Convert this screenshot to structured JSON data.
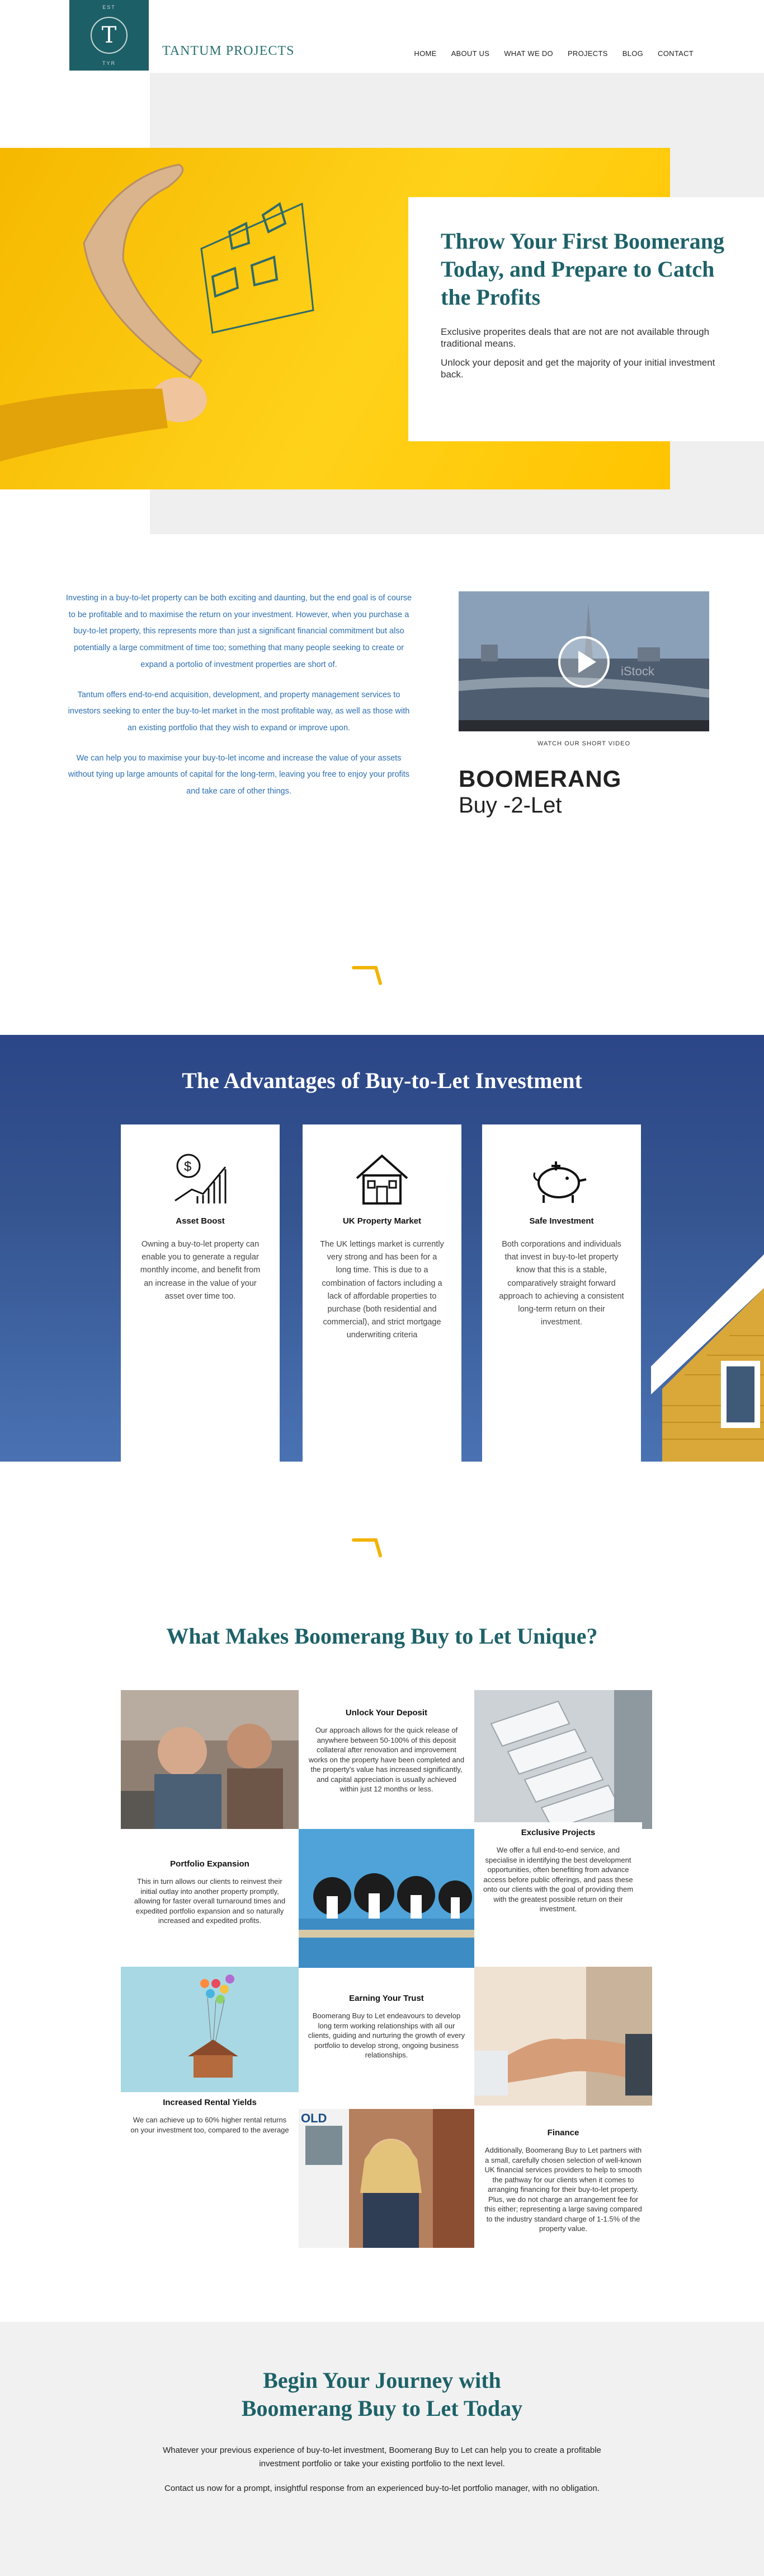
{
  "header": {
    "logo_letter": "T",
    "logo_top": "EST",
    "logo_bottom": "TYR",
    "brand": "TANTUM PROJECTS",
    "nav": [
      "HOME",
      "ABOUT US",
      "WHAT WE DO",
      "PROJECTS",
      "BLOG",
      "CONTACT"
    ]
  },
  "hero": {
    "title": "Throw Your First Boomerang Today, and Prepare to Catch the Profits",
    "p1": "Exclusive properites deals that are not are not available through traditional means.",
    "p2": "Unlock your deposit and get the majority of your initial investment back."
  },
  "intro": {
    "p1": "Investing in a buy-to-let property can be both exciting and daunting, but the end goal is of course to be profitable and to maximise the return on your investment. However, when you purchase a buy-to-let property, this represents more than just a significant financial commitment but also potentially a large commitment of time too; something that many people seeking to create or expand a portolio of investment properties are short of.",
    "p2": "Tantum offers end-to-end acquisition, development, and property management services to investors seeking to enter the buy-to-let market in the most profitable way, as well as those with an existing portfolio that they wish to expand or improve upon.",
    "p3": "We can help you to maximise your buy-to-let income and increase the value of your assets without tying up large amounts of capital for the long-term, leaving you free to enjoy your profits and take care of other things.",
    "video_caption": "WATCH OUR SHORT VIDEO",
    "video_watermark": "iStock",
    "logo_line1": "BOOMERANG",
    "logo_line2": "Buy -2-Let"
  },
  "advantages": {
    "title": "The Advantages of Buy-to-Let Investment",
    "cards": [
      {
        "icon": "money-growth-icon",
        "title": "Asset Boost",
        "text": "Owning a buy-to-let property can enable you to generate a regular monthly income, and benefit from an increase in the value of your asset over time too."
      },
      {
        "icon": "house-icon",
        "title": "UK Property Market",
        "text": "The UK lettings market is currently very strong and has been for a long time. This is due to a combination of factors including a lack of affordable properties to purchase (both residential and commercial), and strict mortgage underwriting criteria"
      },
      {
        "icon": "piggy-bank-icon",
        "title": "Safe Investment",
        "text": "Both corporations and individuals that invest in buy-to-let property know that this is a stable, comparatively straight forward approach to achieving a consistent long-term return on their investment."
      }
    ]
  },
  "unique": {
    "title": "What Makes Boomerang Buy to Let Unique?",
    "tiles": [
      {
        "title": "Unlock Your Deposit",
        "text": "Our approach allows for the quick release of anywhere between 50-100% of this deposit collateral after renovation and improvement works on the property have been completed and the property's value has increased significantly, and capital appreciation is usually achieved within just 12 months or less."
      },
      {
        "title": "Exclusive Projects",
        "text": "We offer a full end-to-end service, and specialise in identifying the best development opportunities, often benefiting from advance access before public offerings, and pass these onto our clients with the goal of providing them with the greatest possible return on their investment."
      },
      {
        "title": "Portfolio Expansion",
        "text": "This in turn allows our clients to reinvest their initial outlay into another property promptly, allowing for faster overall turnaround times and expedited portfolio expansion and so naturally increased and expedited profits."
      },
      {
        "title": "Earning Your Trust",
        "text": "Boomerang Buy to Let endeavours to develop long term working relationships with all our clients, guiding and nurturing the growth of every portfolio to develop strong, ongoing business relationships."
      },
      {
        "title": "Increased Rental Yields",
        "text": "We can achieve up to 60% higher rental returns on your investment too, compared to the average"
      },
      {
        "title": "Finance",
        "text": "Additionally, Boomerang Buy to Let partners with a small, carefully chosen selection of well-known UK financial services providers to help to smooth the pathway for our clients when it comes to arranging financing for their buy-to-let property. Plus, we do not charge an arrangement fee for this either; representing a large saving compared to the industry standard charge of 1-1.5% of the property value."
      }
    ],
    "sign_text": "OLD"
  },
  "journey": {
    "title_line1": "Begin Your Journey with",
    "title_line2": "Boomerang Buy to Let Today",
    "p1": "Whatever your previous experience of buy-to-let investment, Boomerang Buy to Let can help you to create a profitable investment portfolio or take your existing portfolio to the next level.",
    "p2": "Contact us now for a prompt, insightful response from an experienced buy-to-let portfolio manager, with no obligation."
  },
  "colors": {
    "teal": "#1d6268",
    "yellow": "#ffc400",
    "navy": "#2c4687",
    "accent": "#f2b400"
  }
}
